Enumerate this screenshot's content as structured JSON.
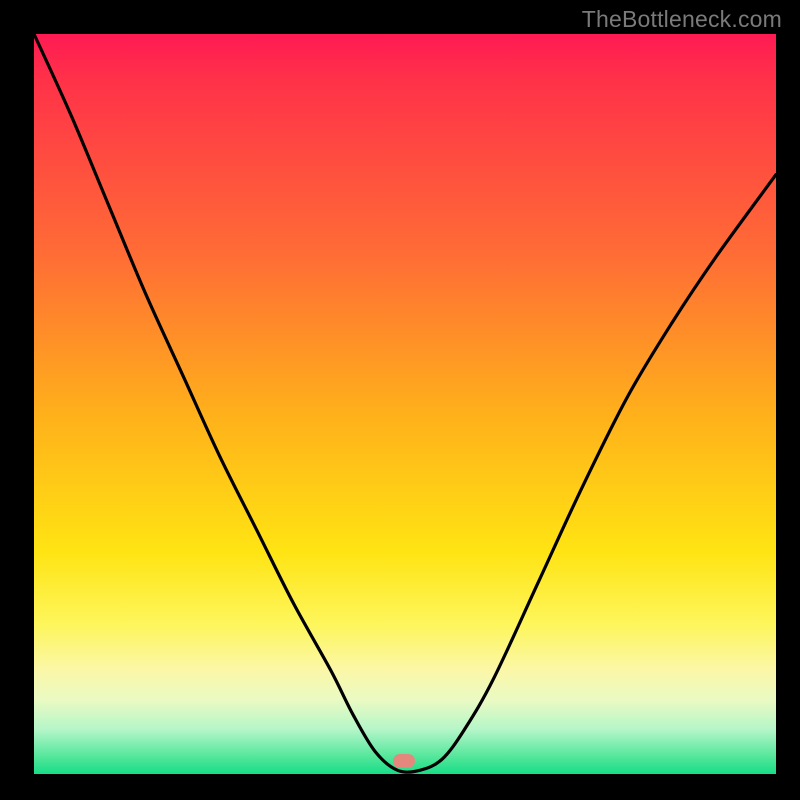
{
  "watermark": "TheBottleneck.com",
  "marker": {
    "x_frac": 0.498,
    "y_frac": 0.983,
    "color": "#e4887d"
  },
  "chart_data": {
    "type": "line",
    "title": "",
    "xlabel": "",
    "ylabel": "",
    "xlim": [
      0,
      1
    ],
    "ylim": [
      0,
      1
    ],
    "background_gradient": [
      {
        "stop": 0.0,
        "color": "#ff1a53"
      },
      {
        "stop": 0.3,
        "color": "#ff6d35"
      },
      {
        "stop": 0.52,
        "color": "#ffb21a"
      },
      {
        "stop": 0.7,
        "color": "#ffe413"
      },
      {
        "stop": 0.86,
        "color": "#fbf7a8"
      },
      {
        "stop": 0.94,
        "color": "#b4f6c8"
      },
      {
        "stop": 1.0,
        "color": "#17dd87"
      }
    ],
    "series": [
      {
        "name": "curve",
        "x": [
          0.0,
          0.05,
          0.1,
          0.15,
          0.2,
          0.25,
          0.3,
          0.35,
          0.4,
          0.43,
          0.46,
          0.49,
          0.52,
          0.55,
          0.58,
          0.62,
          0.68,
          0.74,
          0.8,
          0.86,
          0.92,
          1.0
        ],
        "y": [
          1.0,
          0.89,
          0.77,
          0.65,
          0.54,
          0.43,
          0.33,
          0.23,
          0.14,
          0.08,
          0.03,
          0.005,
          0.005,
          0.02,
          0.06,
          0.13,
          0.26,
          0.39,
          0.51,
          0.61,
          0.7,
          0.81
        ]
      }
    ],
    "annotations": [
      {
        "type": "marker",
        "x": 0.498,
        "y": 0.017
      }
    ]
  }
}
